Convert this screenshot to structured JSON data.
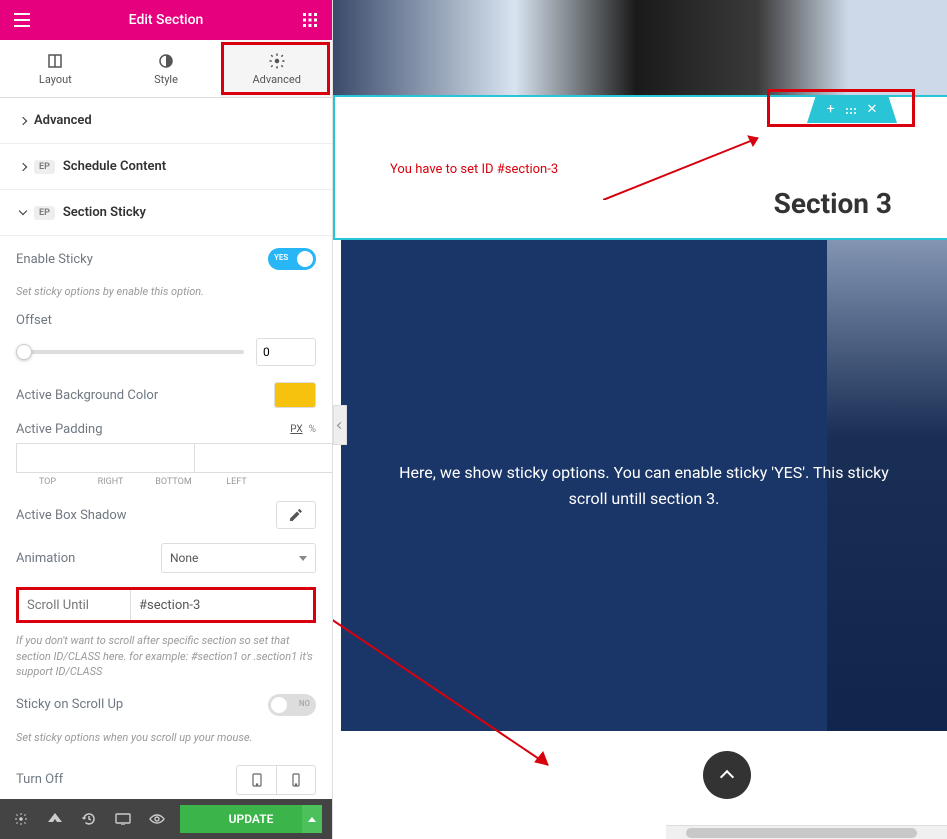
{
  "header": {
    "title": "Edit Section"
  },
  "tabs": {
    "layout": "Layout",
    "style": "Style",
    "advanced": "Advanced"
  },
  "accordion": {
    "advanced": "Advanced",
    "schedule": "Schedule Content",
    "sticky": "Section Sticky",
    "badge": "EP"
  },
  "sticky": {
    "enable_label": "Enable Sticky",
    "enable_hint": "Set sticky options by enable this option.",
    "offset_label": "Offset",
    "offset_value": "0",
    "bg_label": "Active Background Color",
    "padding_label": "Active Padding",
    "unit_px": "PX",
    "unit_pct": "%",
    "pad_top": "TOP",
    "pad_right": "RIGHT",
    "pad_bottom": "BOTTOM",
    "pad_left": "LEFT",
    "shadow_label": "Active Box Shadow",
    "anim_label": "Animation",
    "anim_value": "None",
    "scroll_label": "Scroll Until",
    "scroll_value": "#section-3",
    "scroll_hint": "If you don't want to scroll after specific section so set that section ID/CLASS here. for example: #section1 or .section1 it's support ID/CLASS",
    "scrollup_label": "Sticky on Scroll Up",
    "scrollup_hint": "Set sticky options when you scroll up your mouse.",
    "turnoff_label": "Turn Off"
  },
  "toggle": {
    "yes": "YES",
    "no": "NO"
  },
  "footer": {
    "update": "UPDATE"
  },
  "preview": {
    "annotation": "You have to set ID #section-3",
    "section_title": "Section 3",
    "body_text": "Here, we show sticky options. You can enable sticky 'YES'. This sticky scroll untill section 3."
  },
  "colors": {
    "accent": "#e6007e",
    "highlight": "#d8000c",
    "cyan": "#29c4d6",
    "toggle_on": "#29b6f6",
    "swatch": "#f6c20e",
    "update": "#3bb54a",
    "navy": "#1a3668"
  }
}
